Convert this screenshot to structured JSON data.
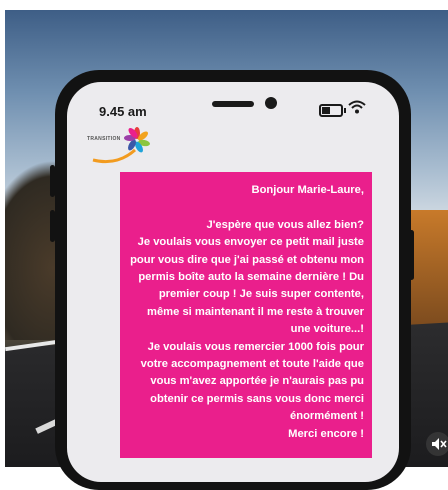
{
  "status_bar": {
    "time": "9.45 am"
  },
  "logo": {
    "text": "TRANSITION"
  },
  "message": {
    "greeting": "Bonjour Marie-Laure,",
    "line1": "J'espère que vous allez bien?",
    "line2": "Je voulais vous envoyer ce petit mail juste pour vous dire que j'ai passé et obtenu mon permis boîte auto la semaine dernière ! Du premier coup ! Je suis super contente, même si maintenant il me reste à trouver une voiture...!",
    "line3": "Je voulais vous remercier 1000 fois pour votre accompagnement et toute l'aide que vous m'avez apportée je n'aurais pas pu obtenir ce permis sans vous donc merci énormément !",
    "line4": "Merci encore !"
  },
  "colors": {
    "message_bg": "#ea1f8c",
    "phone_frame": "#121212",
    "screen_bg": "#ecebee"
  },
  "icons": [
    "battery-icon",
    "wifi-icon",
    "logo-flower-icon",
    "mute-icon"
  ]
}
